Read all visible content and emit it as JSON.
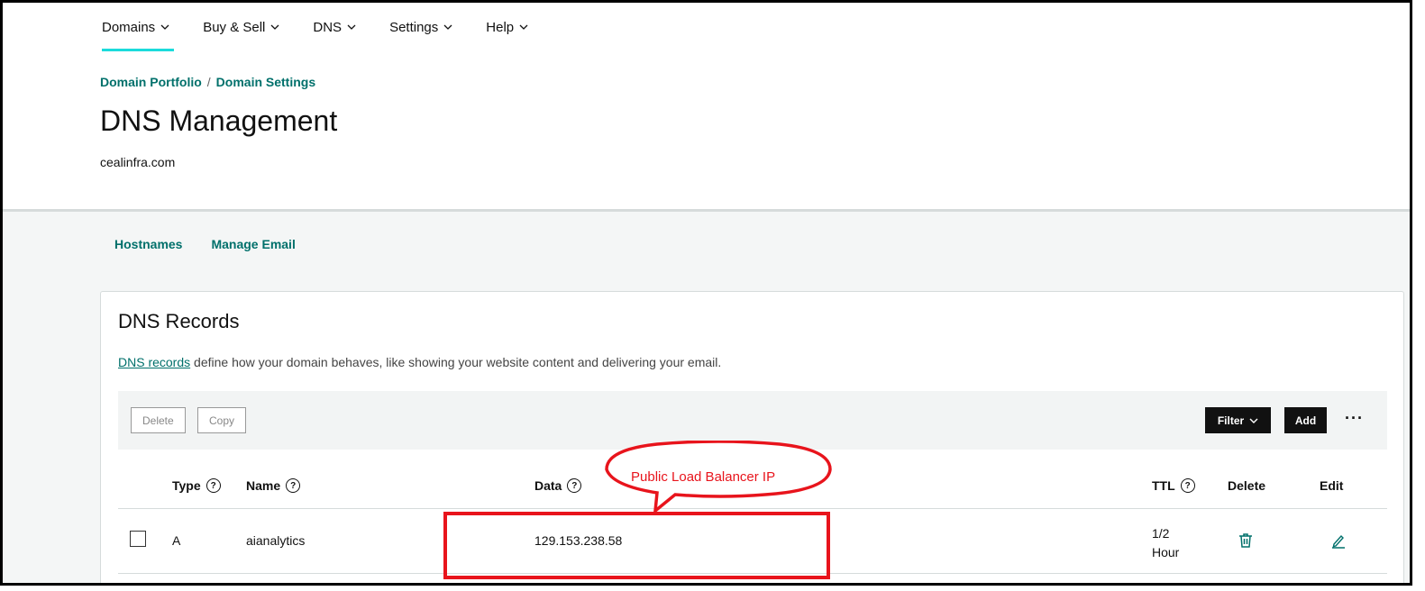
{
  "nav": {
    "items": [
      {
        "label": "Domains"
      },
      {
        "label": "Buy & Sell"
      },
      {
        "label": "DNS"
      },
      {
        "label": "Settings"
      },
      {
        "label": "Help"
      }
    ]
  },
  "breadcrumb": {
    "items": [
      "Domain Portfolio",
      "Domain Settings"
    ],
    "separator": "/"
  },
  "page": {
    "title": "DNS Management",
    "domain": "cealinfra.com"
  },
  "subtabs": [
    "Hostnames",
    "Manage Email"
  ],
  "records": {
    "title": "DNS Records",
    "desc_link": "DNS records",
    "desc_rest": " define how your domain behaves, like showing your website content and delivering your email.",
    "toolbar": {
      "delete": "Delete",
      "copy": "Copy",
      "filter": "Filter",
      "add": "Add",
      "more": "···"
    },
    "columns": {
      "type": "Type",
      "name": "Name",
      "data": "Data",
      "ttl": "TTL",
      "delete": "Delete",
      "edit": "Edit"
    },
    "rows": [
      {
        "type": "A",
        "name": "aianalytics",
        "data": "129.153.238.58",
        "ttl_line1": "1/2",
        "ttl_line2": "Hour"
      }
    ]
  },
  "annotation": {
    "text": "Public Load Balancer IP",
    "color": "#e8141c"
  },
  "colors": {
    "accent": "#00706b",
    "nav_underline": "#1bdbdb"
  }
}
